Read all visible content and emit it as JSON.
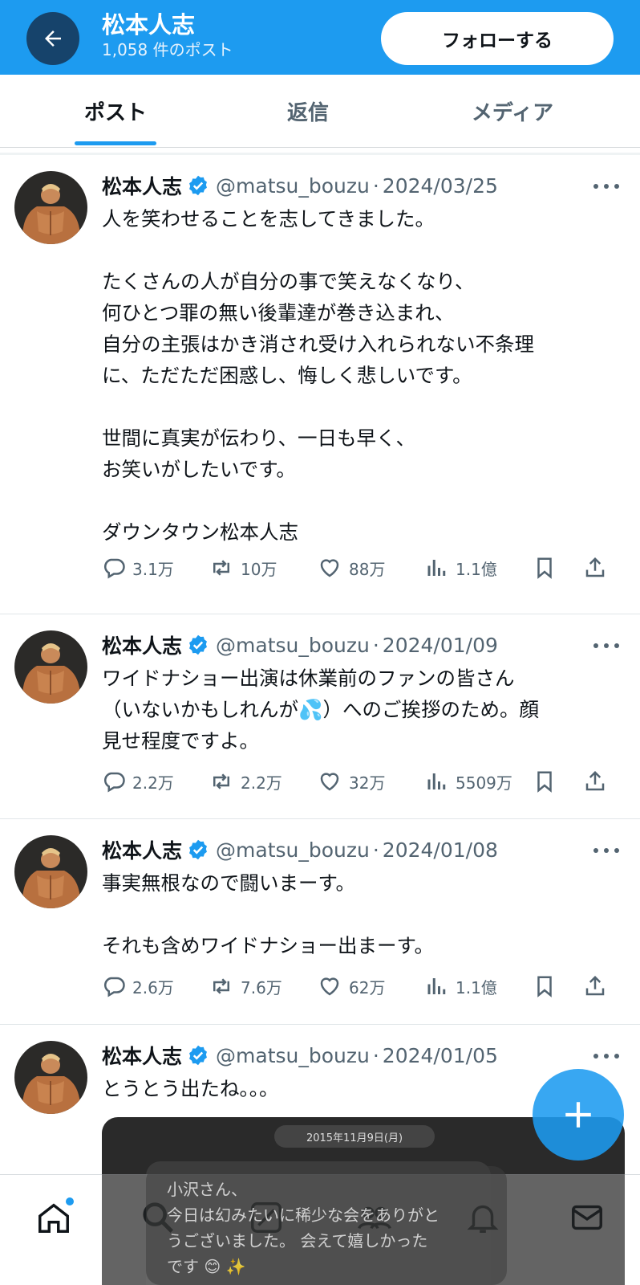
{
  "header": {
    "name": "松本人志",
    "post_count": "1,058 件のポスト",
    "follow_label": "フォローする"
  },
  "tabs": [
    {
      "label": "ポスト",
      "active": true
    },
    {
      "label": "返信",
      "active": false
    },
    {
      "label": "メディア",
      "active": false
    }
  ],
  "posts": [
    {
      "name": "松本人志",
      "handle": "@matsu_bouzu",
      "date": "2024/03/25",
      "text": "人を笑わせることを志してきました。\n\nたくさんの人が自分の事で笑えなくなり、\n何ひとつ罪の無い後輩達が巻き込まれ、\n自分の主張はかき消され受け入れられない不条理\nに、ただただ困惑し、悔しく悲しいです。\n\n世間に真実が伝わり、一日も早く、\nお笑いがしたいです。\n\nダウンタウン松本人志",
      "replies": "3.1万",
      "reposts": "10万",
      "likes": "88万",
      "views": "1.1億"
    },
    {
      "name": "松本人志",
      "handle": "@matsu_bouzu",
      "date": "2024/01/09",
      "text": "ワイドナショー出演は休業前のファンの皆さん\n（いないかもしれんが💦）へのご挨拶のため。顔\n見せ程度ですよ。",
      "replies": "2.2万",
      "reposts": "2.2万",
      "likes": "32万",
      "views": "5509万"
    },
    {
      "name": "松本人志",
      "handle": "@matsu_bouzu",
      "date": "2024/01/08",
      "text": "事実無根なので闘いまーす。\n\nそれも含めワイドナショー出まーす。",
      "replies": "2.6万",
      "reposts": "7.6万",
      "likes": "62万",
      "views": "1.1億"
    },
    {
      "name": "松本人志",
      "handle": "@matsu_bouzu",
      "date": "2024/01/05",
      "text": "とうとう出たね。。。",
      "media_date": "2015年11月9日(月)",
      "media_text": "小沢さん、\n今日は幻みたいに稀少な会をありがと\nうございました。 会えて嬉しかった\nです 😊 ✨"
    }
  ],
  "colors": {
    "accent": "#1d9bf0",
    "back_button": "#16436b",
    "secondary_text": "#536471",
    "verified": "#1d9bf0"
  },
  "icons": {
    "back": "arrow-left-icon",
    "more": "more-dots-icon",
    "reply": "speech-bubble-icon",
    "repost": "repost-arrows-icon",
    "like": "heart-icon",
    "views": "bar-chart-icon",
    "bookmark": "bookmark-icon",
    "share": "share-upload-icon",
    "compose": "plus-icon",
    "nav": [
      "home-icon",
      "search-icon",
      "grok-icon",
      "communities-icon",
      "bell-icon",
      "mail-icon"
    ]
  }
}
